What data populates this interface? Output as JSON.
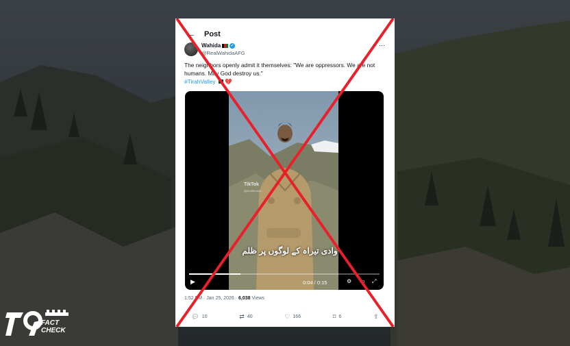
{
  "header": {
    "back_icon": "back-arrow-icon",
    "title": "Post"
  },
  "author": {
    "name": "Wahida",
    "handle": "@RealWahidaAFG",
    "flag": "afghanistan-flag-icon",
    "verified": true
  },
  "tweet": {
    "text": "The neighbors openly admit it themselves: \"We are oppressors. We are not humans. May God destroy us.\"",
    "hashtag": "#TirahValley",
    "emoji": "💔"
  },
  "video": {
    "watermark": "TikTok",
    "watermark_handle": "@3248hfranki...",
    "caption": "وادی تیراہ کے لوگوں پر ظلم",
    "time": "0:04 / 0:15",
    "progress": 0.27
  },
  "meta": {
    "timestamp": "1:52 PM · Jan 25, 2026 · ",
    "views_count": "6,038",
    "views_label": " Views"
  },
  "actions": {
    "replies": "10",
    "reposts": "40",
    "likes": "166",
    "bookmarks": "6"
  },
  "overlay": {
    "cross_color": "#e8202a"
  },
  "logo": {
    "line1": "FACT",
    "line2": "CHECK"
  }
}
